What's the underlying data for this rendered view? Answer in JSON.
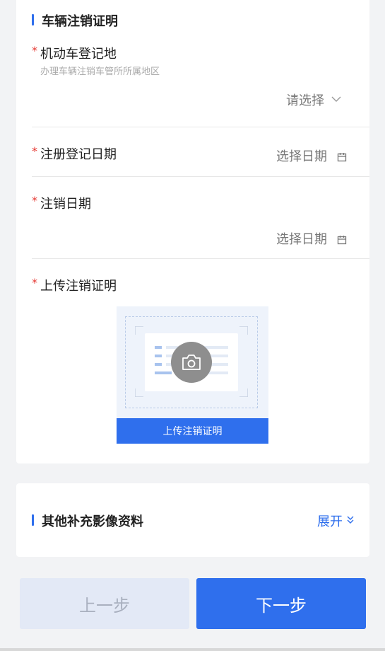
{
  "cancel_section": {
    "title": "车辆注销证明",
    "fields": [
      {
        "required_mark": "*",
        "label": "机动车登记地",
        "hint": "办理车辆注销车管所所属地区",
        "value": "请选择",
        "icon": "chevron-down-icon"
      },
      {
        "required_mark": "*",
        "label": "注册登记日期",
        "value": "选择日期",
        "icon": "calendar-icon"
      },
      {
        "required_mark": "*",
        "label": "注销日期",
        "value": "选择日期",
        "icon": "calendar-icon"
      },
      {
        "required_mark": "*",
        "label": "上传注销证明"
      }
    ],
    "upload": {
      "label": "上传注销证明",
      "icon": "camera-icon"
    }
  },
  "other_section": {
    "title": "其他补充影像资料",
    "expand_label": "展开",
    "expand_icon": "double-chevron-down-icon"
  },
  "footer": {
    "prev_label": "上一步",
    "next_label": "下一步"
  },
  "colors": {
    "accent": "#2f6fed",
    "required": "#e5352f",
    "disabled_bg": "#e3e9f6"
  }
}
